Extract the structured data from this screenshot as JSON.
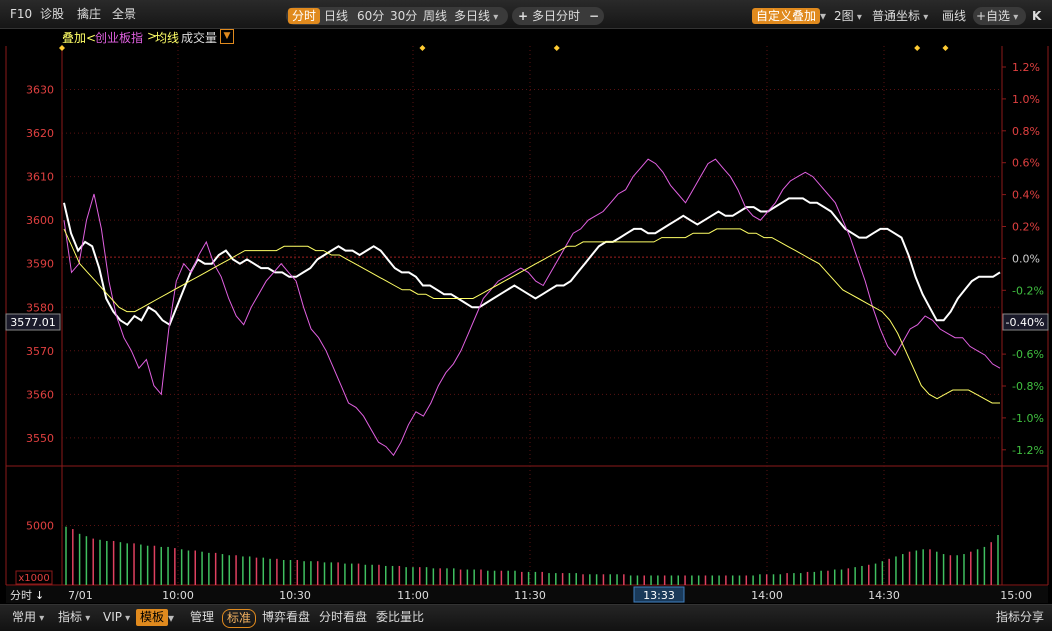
{
  "toolbar": {
    "f10": "F10",
    "diagnose": "诊股",
    "dealer": "擒庄",
    "panorama": "全景",
    "period_tabs": [
      "分时",
      "日线",
      "60分",
      "30分",
      "周线",
      "多日线"
    ],
    "multi_day": "多日分时",
    "plus": "+",
    "minus": "−",
    "custom_overlay": "自定义叠加",
    "two_charts": "2图",
    "coordinate": "普通坐标",
    "draw_line": "画线",
    "watchlist": "+自选",
    "collapse": "K",
    "accent_color": "#e08a1e"
  },
  "overlay_legend": {
    "prefix": "叠加<",
    "index_name": "创业板指",
    "suffix": ">",
    "avg_line": "均线",
    "volume": "成交量",
    "avg_color": "#ffff66",
    "index_color": "#e060e0"
  },
  "crosshair": {
    "price": "3577.01",
    "percent": "-0.40%",
    "time": "13:33"
  },
  "volume_panel": {
    "tick": "5000",
    "unit": "x1000"
  },
  "time_footer": {
    "mode": "分时",
    "labels": [
      "7/01",
      "10:00",
      "10:30",
      "11:00",
      "11:30",
      "14:00",
      "14:30",
      "15:00"
    ]
  },
  "bottombar": {
    "common": "常用",
    "indicator": "指标",
    "vip": "VIP",
    "template": "模板",
    "manage": "管理",
    "standard": "标准",
    "game_view": "博弈看盘",
    "tick_view": "分时看盘",
    "ratio": "委比量比",
    "share": "指标分享"
  },
  "chart_data": {
    "type": "line",
    "y_left": {
      "ticks": [
        3550,
        3560,
        3570,
        3580,
        3590,
        3600,
        3610,
        3620,
        3630
      ],
      "ylim": [
        3544,
        3640
      ]
    },
    "y_right": {
      "ticks": [
        "1.2%",
        "1.0%",
        "0.8%",
        "0.6%",
        "0.4%",
        "0.2%",
        "0.0%",
        "-0.2%",
        "-0.4%",
        "-0.6%",
        "-0.8%",
        "-1.0%",
        "-1.2%"
      ]
    },
    "prev_close": 3591.5,
    "markers": [
      0,
      51,
      70,
      121,
      125
    ],
    "series": [
      {
        "color": "#ffffff",
        "values": [
          3604,
          3597,
          3593,
          3595,
          3594,
          3589,
          3582,
          3579,
          3577,
          3576,
          3578,
          3577,
          3580,
          3579,
          3577,
          3576,
          3580,
          3584,
          3588,
          3591,
          3590,
          3590,
          3592,
          3593,
          3591,
          3590,
          3591,
          3590,
          3589,
          3589,
          3588,
          3588,
          3587,
          3587,
          3588,
          3589,
          3591,
          3592,
          3593,
          3594,
          3593,
          3593,
          3592,
          3593,
          3594,
          3593,
          3591,
          3589,
          3588,
          3588,
          3587,
          3585,
          3585,
          3584,
          3583,
          3583,
          3582,
          3581,
          3580,
          3580,
          3581,
          3582,
          3583,
          3584,
          3585,
          3584,
          3583,
          3582,
          3583,
          3584,
          3585,
          3585,
          3586,
          3588,
          3590,
          3592,
          3594,
          3595,
          3595,
          3596,
          3597,
          3598,
          3598,
          3597,
          3597,
          3598,
          3599,
          3600,
          3601,
          3600,
          3599,
          3600,
          3601,
          3602,
          3601,
          3601,
          3602,
          3603,
          3603,
          3602,
          3602,
          3603,
          3604,
          3605,
          3605,
          3605,
          3604,
          3604,
          3603,
          3602,
          3600,
          3598,
          3597,
          3596,
          3596,
          3597,
          3598,
          3598,
          3597,
          3596,
          3592,
          3587,
          3583,
          3580,
          3577,
          3577,
          3579,
          3582,
          3584,
          3586,
          3587,
          3587,
          3587,
          3588
        ]
      },
      {
        "color": "#e060e0",
        "values": [
          3600,
          3588,
          3590,
          3600,
          3606,
          3598,
          3586,
          3578,
          3573,
          3570,
          3566,
          3568,
          3562,
          3560,
          3575,
          3586,
          3590,
          3588,
          3592,
          3595,
          3590,
          3587,
          3582,
          3578,
          3576,
          3580,
          3583,
          3586,
          3588,
          3590,
          3588,
          3586,
          3580,
          3575,
          3573,
          3570,
          3566,
          3562,
          3558,
          3557,
          3555,
          3552,
          3549,
          3548,
          3546,
          3549,
          3553,
          3556,
          3555,
          3558,
          3562,
          3565,
          3567,
          3570,
          3574,
          3578,
          3582,
          3584,
          3586,
          3587,
          3588,
          3589,
          3588,
          3586,
          3585,
          3588,
          3591,
          3594,
          3597,
          3598,
          3600,
          3601,
          3602,
          3604,
          3606,
          3607,
          3610,
          3612,
          3614,
          3613,
          3611,
          3608,
          3606,
          3604,
          3607,
          3610,
          3613,
          3614,
          3612,
          3610,
          3607,
          3603,
          3601,
          3600,
          3602,
          3604,
          3607,
          3609,
          3610,
          3611,
          3610,
          3608,
          3606,
          3604,
          3600,
          3596,
          3591,
          3586,
          3580,
          3575,
          3571,
          3569,
          3572,
          3575,
          3576,
          3578,
          3577,
          3575,
          3574,
          3573,
          3573,
          3571,
          3570,
          3569,
          3567,
          3566
        ]
      },
      {
        "color": "#ffff66",
        "values": [
          3598,
          3594,
          3590,
          3588,
          3586,
          3584,
          3582,
          3580,
          3579,
          3579,
          3580,
          3581,
          3582,
          3583,
          3584,
          3585,
          3586,
          3587,
          3588,
          3589,
          3590,
          3591,
          3592,
          3593,
          3593,
          3593,
          3593,
          3593,
          3594,
          3594,
          3594,
          3594,
          3593,
          3593,
          3592,
          3592,
          3591,
          3590,
          3589,
          3588,
          3587,
          3586,
          3585,
          3584,
          3584,
          3583,
          3583,
          3582,
          3582,
          3582,
          3582,
          3582,
          3582,
          3583,
          3584,
          3585,
          3586,
          3587,
          3588,
          3589,
          3590,
          3591,
          3592,
          3593,
          3594,
          3594,
          3595,
          3595,
          3595,
          3595,
          3595,
          3595,
          3595,
          3595,
          3595,
          3595,
          3596,
          3596,
          3596,
          3596,
          3597,
          3597,
          3597,
          3598,
          3598,
          3598,
          3598,
          3597,
          3597,
          3596,
          3596,
          3595,
          3594,
          3593,
          3592,
          3591,
          3590,
          3588,
          3586,
          3584,
          3583,
          3582,
          3581,
          3580,
          3579,
          3577,
          3574,
          3570,
          3566,
          3562,
          3560,
          3559,
          3560,
          3561,
          3561,
          3561,
          3560,
          3559,
          3558,
          3558
        ]
      }
    ],
    "volume": {
      "ylim": [
        0,
        10000
      ],
      "values": [
        4900,
        4700,
        4300,
        4100,
        3900,
        3800,
        3700,
        3700,
        3600,
        3500,
        3500,
        3400,
        3300,
        3300,
        3200,
        3200,
        3100,
        3000,
        2900,
        2900,
        2800,
        2700,
        2700,
        2600,
        2500,
        2500,
        2400,
        2400,
        2300,
        2300,
        2200,
        2200,
        2100,
        2100,
        2100,
        2000,
        2000,
        2000,
        1900,
        1900,
        1900,
        1800,
        1800,
        1800,
        1700,
        1700,
        1700,
        1600,
        1600,
        1600,
        1500,
        1500,
        1500,
        1500,
        1400,
        1400,
        1400,
        1400,
        1300,
        1300,
        1300,
        1300,
        1200,
        1200,
        1200,
        1200,
        1200,
        1100,
        1100,
        1100,
        1100,
        1000,
        1000,
        1000,
        1000,
        1000,
        900,
        900,
        900,
        900,
        900,
        900,
        900,
        800,
        800,
        800,
        800,
        800,
        800,
        800,
        800,
        800,
        800,
        800,
        800,
        800,
        800,
        800,
        800,
        800,
        800,
        800,
        900,
        900,
        900,
        900,
        1000,
        1000,
        1000,
        1100,
        1100,
        1200,
        1200,
        1300,
        1300,
        1400,
        1500,
        1600,
        1700,
        1800,
        2000,
        2200,
        2400,
        2600,
        2800,
        2900,
        3000,
        3000,
        2800,
        2600,
        2500,
        2500,
        2600,
        2800,
        3000,
        3200,
        3600,
        4200
      ]
    }
  }
}
